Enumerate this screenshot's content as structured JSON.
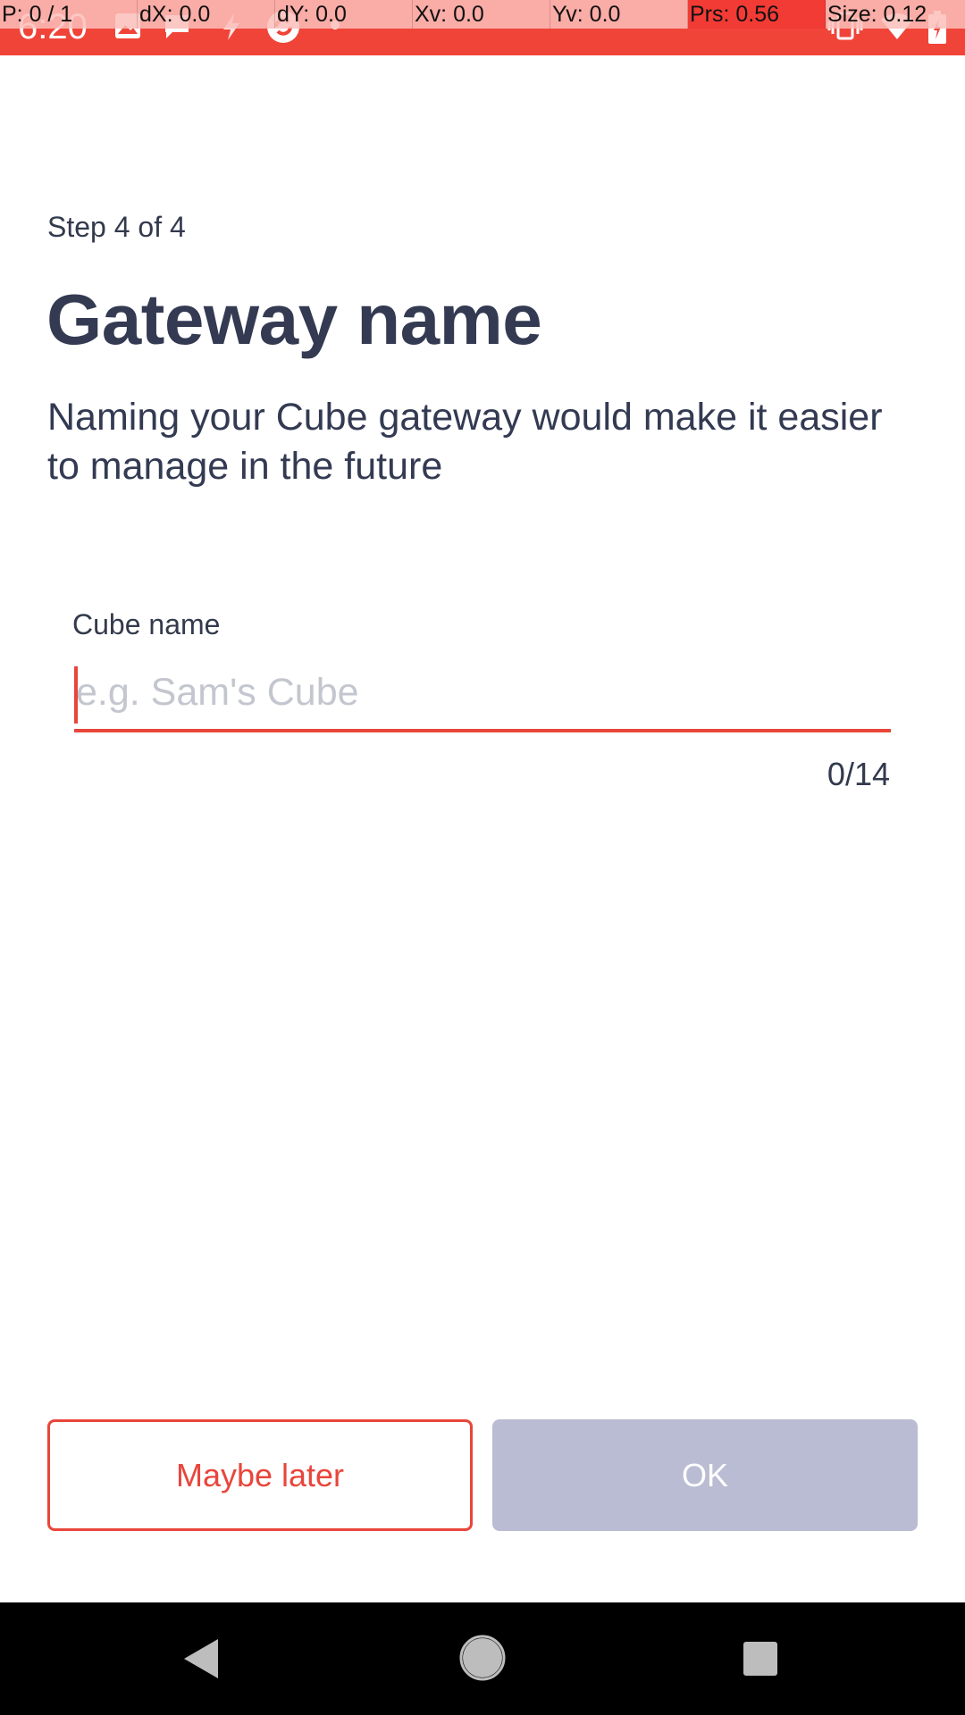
{
  "status_bar": {
    "time": "6:20",
    "icons": [
      "image-icon",
      "chat-icon",
      "flash-icon",
      "sync-icon",
      "dot-icon",
      "vibrate-icon",
      "wifi-icon",
      "battery-icon"
    ]
  },
  "debug_overlay": {
    "pointer": "P: 0 / 1",
    "dx": "dX: 0.0",
    "dy": "dY: 0.0",
    "xv": "Xv: 0.0",
    "yv": "Yv: 0.0",
    "prs": "Prs: 0.56",
    "size": "Size: 0.12"
  },
  "header": {
    "step": "Step 4 of 4",
    "title": "Gateway name",
    "subtitle": "Naming your Cube gateway would make it easier to manage in the future"
  },
  "form": {
    "label": "Cube name",
    "value": "",
    "placeholder": "e.g. Sam's Cube",
    "counter": "0/14"
  },
  "actions": {
    "secondary_label": "Maybe later",
    "primary_label": "OK"
  },
  "colors": {
    "accent": "#e8463b",
    "status_bar": "#f04438",
    "text_dark": "#333a52",
    "disabled_button": "#b9bcd2"
  },
  "nav_bar": {
    "icons": [
      "back-icon",
      "home-icon",
      "recents-icon"
    ]
  }
}
